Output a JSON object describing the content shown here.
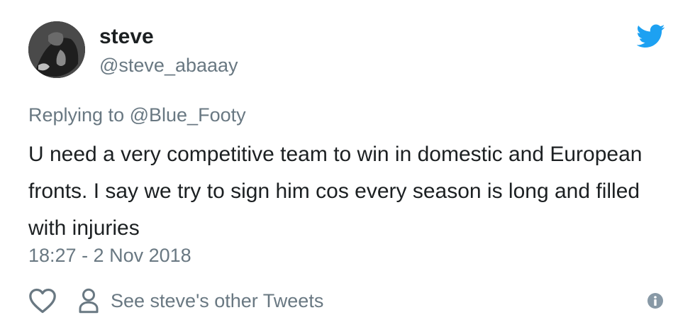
{
  "tweet": {
    "author": {
      "display_name": "steve",
      "handle": "@steve_abaaay"
    },
    "replying_to": {
      "prefix": "Replying to",
      "handle": "@Blue_Footy"
    },
    "text": "U need a very competitive team to win in domestic and European fronts. I say we try to sign him cos every season is long and filled with injuries",
    "timestamp": "18:27 - 2 Nov 2018"
  },
  "actions": {
    "like_icon": "heart-icon",
    "other_tweets_icon": "person-icon",
    "other_tweets_label": "See steve's other Tweets",
    "info_icon": "info-icon"
  },
  "colors": {
    "text": "#1c2022",
    "secondary": "#697882",
    "twitter_blue": "#1da1f2"
  }
}
